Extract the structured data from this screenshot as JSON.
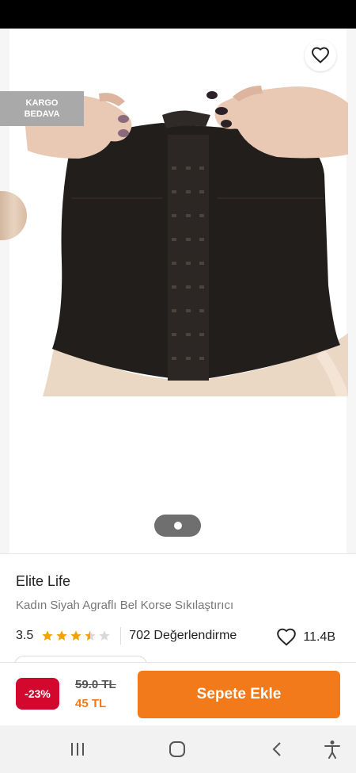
{
  "badges": {
    "cargo_line1": "KARGO",
    "cargo_line2": "BEDAVA"
  },
  "product": {
    "brand": "Elite Life",
    "name": "Kadın Siyah Agraflı Bel Korse Sıkılaştırıcı",
    "rating": "3.5",
    "rating_stars": 3.5,
    "reviews": "702 Değerlendirme",
    "favorites": "11.4B"
  },
  "pricing": {
    "discount": "-23%",
    "old_price": "59.0 TL",
    "new_price": "45 TL",
    "add_to_cart": "Sepete Ekle"
  },
  "gallery": {
    "current_page": 1,
    "total_pages": 1
  },
  "colors": {
    "accent": "#f27a1a",
    "discount": "#d3082f",
    "star": "#f2a300",
    "star_empty": "#d9d9d9",
    "badge_bg": "#a9a9a9"
  },
  "icons": {
    "back": "back-arrow-icon",
    "share": "share-icon",
    "favorite": "heart-outline-icon",
    "nav_recents": "recent-apps-icon",
    "nav_home": "home-icon",
    "nav_back": "nav-back-icon",
    "accessibility": "accessibility-icon"
  }
}
